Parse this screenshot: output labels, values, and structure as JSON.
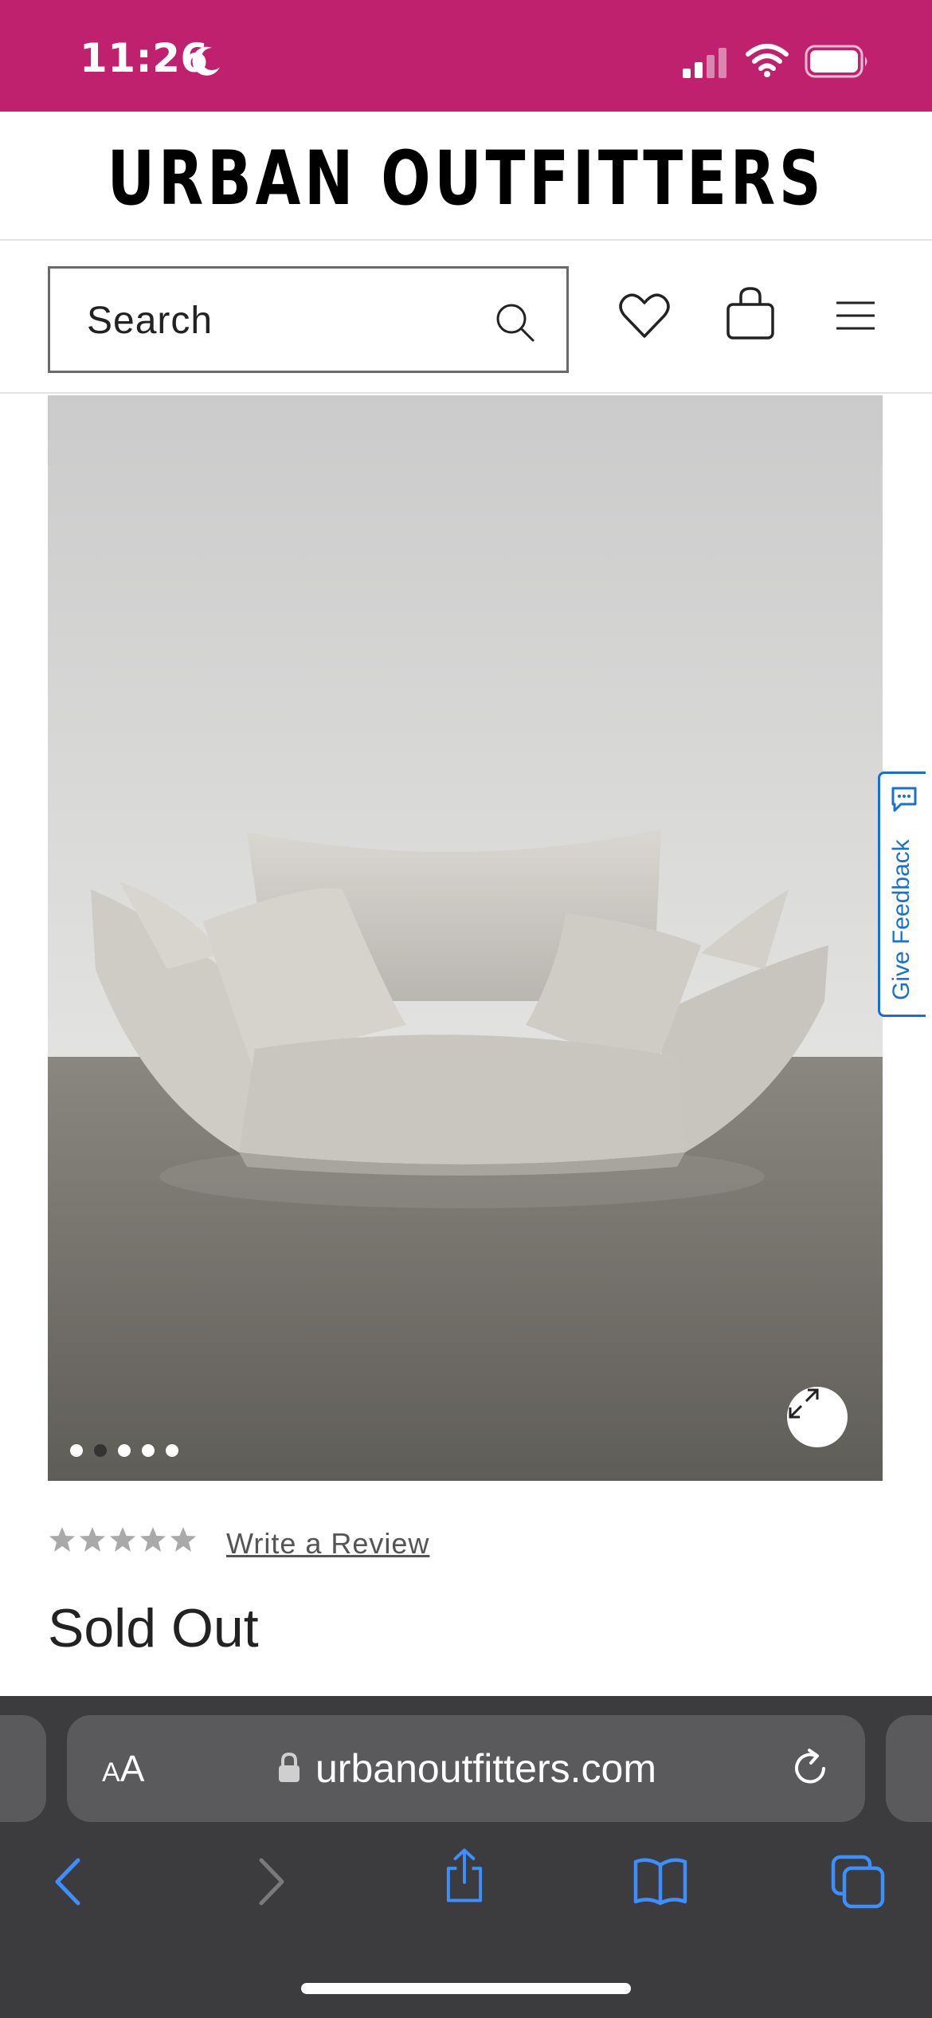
{
  "status_bar": {
    "time": "11:26",
    "background_color": "#c0216f",
    "icons": [
      "moon-icon",
      "signal-icon",
      "wifi-icon",
      "battery-icon"
    ]
  },
  "header": {
    "logo": "URBAN OUTFITTERS"
  },
  "search": {
    "placeholder": "Search",
    "icons": [
      "search-icon",
      "heart-icon",
      "bag-icon",
      "menu-icon"
    ]
  },
  "product": {
    "image_count": 5,
    "active_image": 2,
    "expand_icon": "expand-icon",
    "feedback_label": "Give Feedback",
    "rating_stars": 5,
    "rating_filled": 0,
    "write_review": "Write a Review",
    "status": "Sold Out"
  },
  "browser": {
    "text_size_label_small": "A",
    "text_size_label_large": "A",
    "url": "urbanoutfitters.com",
    "accent_color": "#3d8eff",
    "nav_icons": [
      "back-icon",
      "forward-icon",
      "share-icon",
      "bookmarks-icon",
      "tabs-icon"
    ]
  }
}
